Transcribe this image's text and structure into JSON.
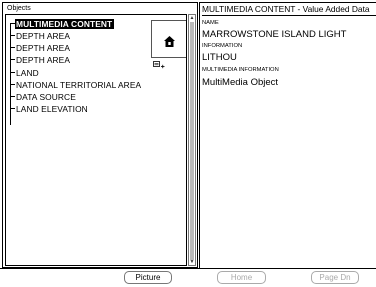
{
  "objects_panel": {
    "title": "Objects",
    "items": [
      {
        "label": "MULTIMEDIA CONTENT",
        "selected": true
      },
      {
        "label": "DEPTH AREA",
        "selected": false
      },
      {
        "label": "DEPTH AREA",
        "selected": false
      },
      {
        "label": "DEPTH AREA",
        "selected": false
      },
      {
        "label": "LAND",
        "selected": false
      },
      {
        "label": "NATIONAL TERRITORIAL AREA",
        "selected": false
      },
      {
        "label": "DATA SOURCE",
        "selected": false
      },
      {
        "label": "LAND ELEVATION",
        "selected": false
      }
    ],
    "thumbnail_icon": "house-icon",
    "picture_indicator_icon": "picture-indicator-icon"
  },
  "details_panel": {
    "header": "MULTIMEDIA CONTENT - Value Added Data",
    "fields": [
      {
        "name": "NAME",
        "value": "MARROWSTONE ISLAND LIGHT"
      },
      {
        "name": "INFORMATION",
        "value": "LITHOU"
      },
      {
        "name": "MULTIMEDIA INFORMATION",
        "value": "MultiMedia Object"
      }
    ]
  },
  "buttons": {
    "picture": "Picture",
    "home": "Home",
    "page_dn": "Page Dn"
  }
}
